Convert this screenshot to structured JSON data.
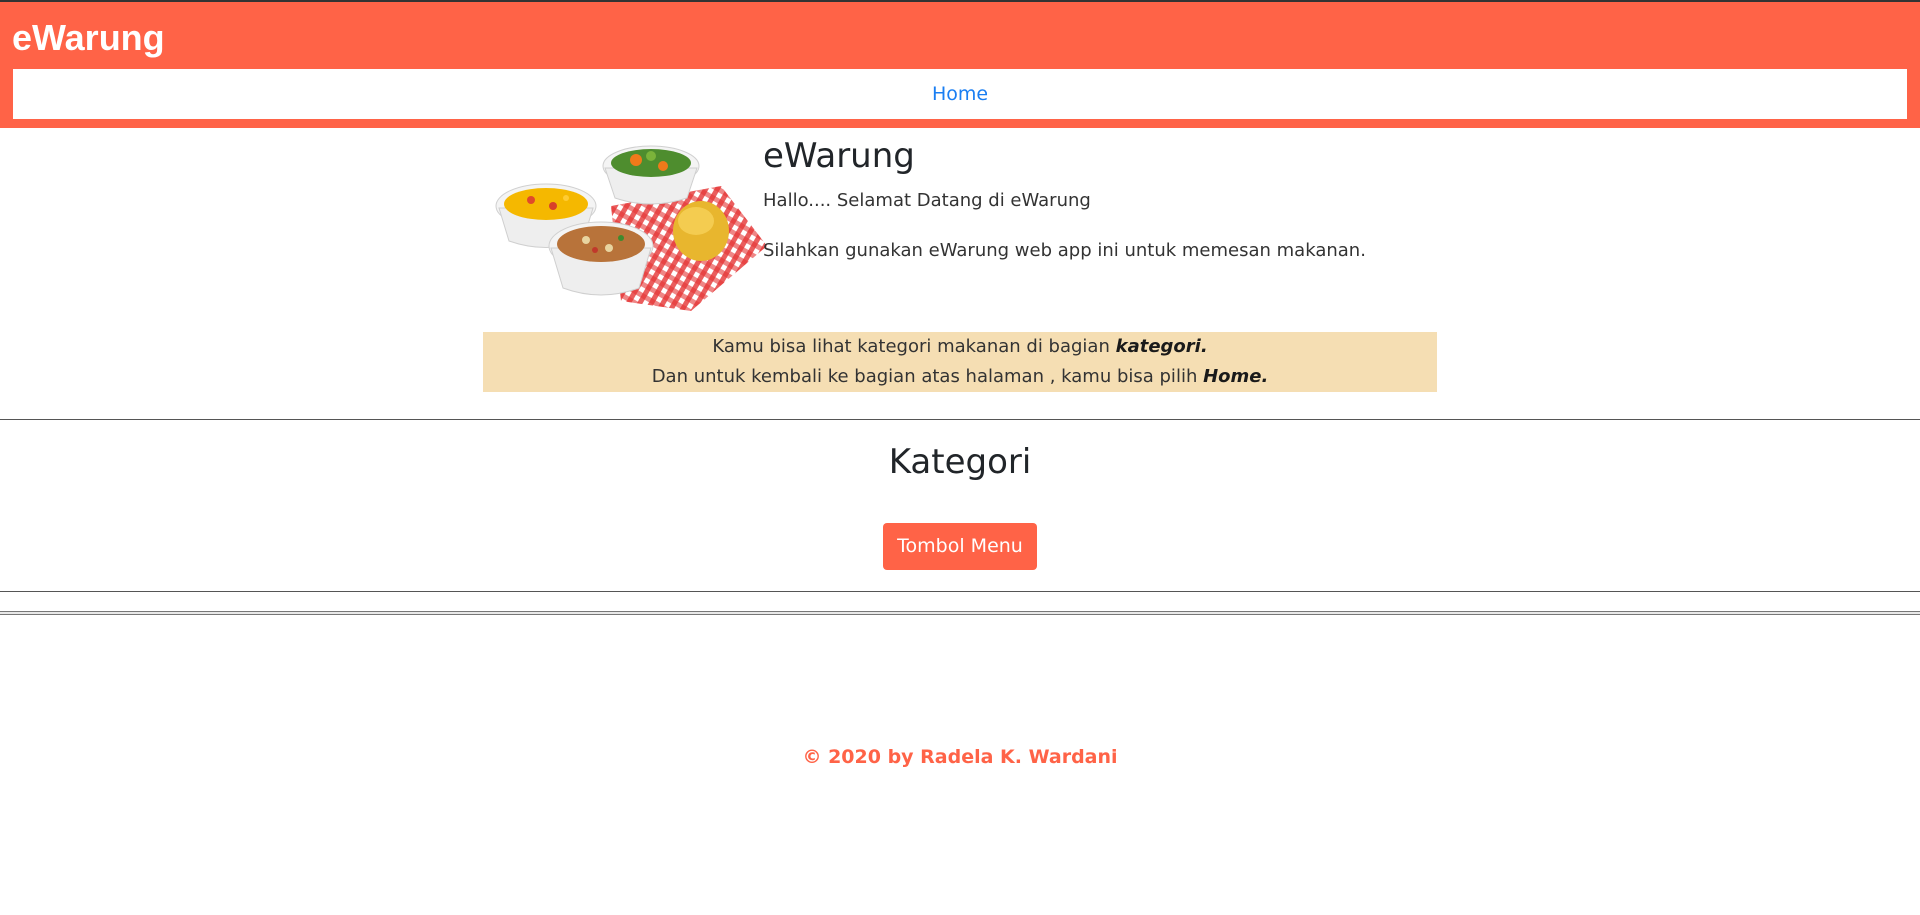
{
  "header": {
    "brand": "eWarung",
    "nav_home": "Home"
  },
  "intro": {
    "title": "eWarung",
    "greeting": "Hallo.... Selamat Datang di eWarung",
    "instruction": "Silahkan gunakan eWarung web app ini untuk memesan makanan."
  },
  "notice": {
    "line1_prefix": "Kamu bisa lihat kategori makanan di bagian ",
    "line1_bold": "kategori.",
    "line2_prefix": "Dan untuk kembali ke bagian atas halaman , kamu bisa pilih ",
    "line2_bold": "Home."
  },
  "kategori": {
    "title": "Kategori",
    "button_label": "Tombol Menu"
  },
  "footer": {
    "text": "© 2020 by Radela K. Wardani"
  },
  "colors": {
    "accent": "#ff6347",
    "nav_link": "#1a7ef2",
    "notice_bg": "#f5deb3"
  }
}
